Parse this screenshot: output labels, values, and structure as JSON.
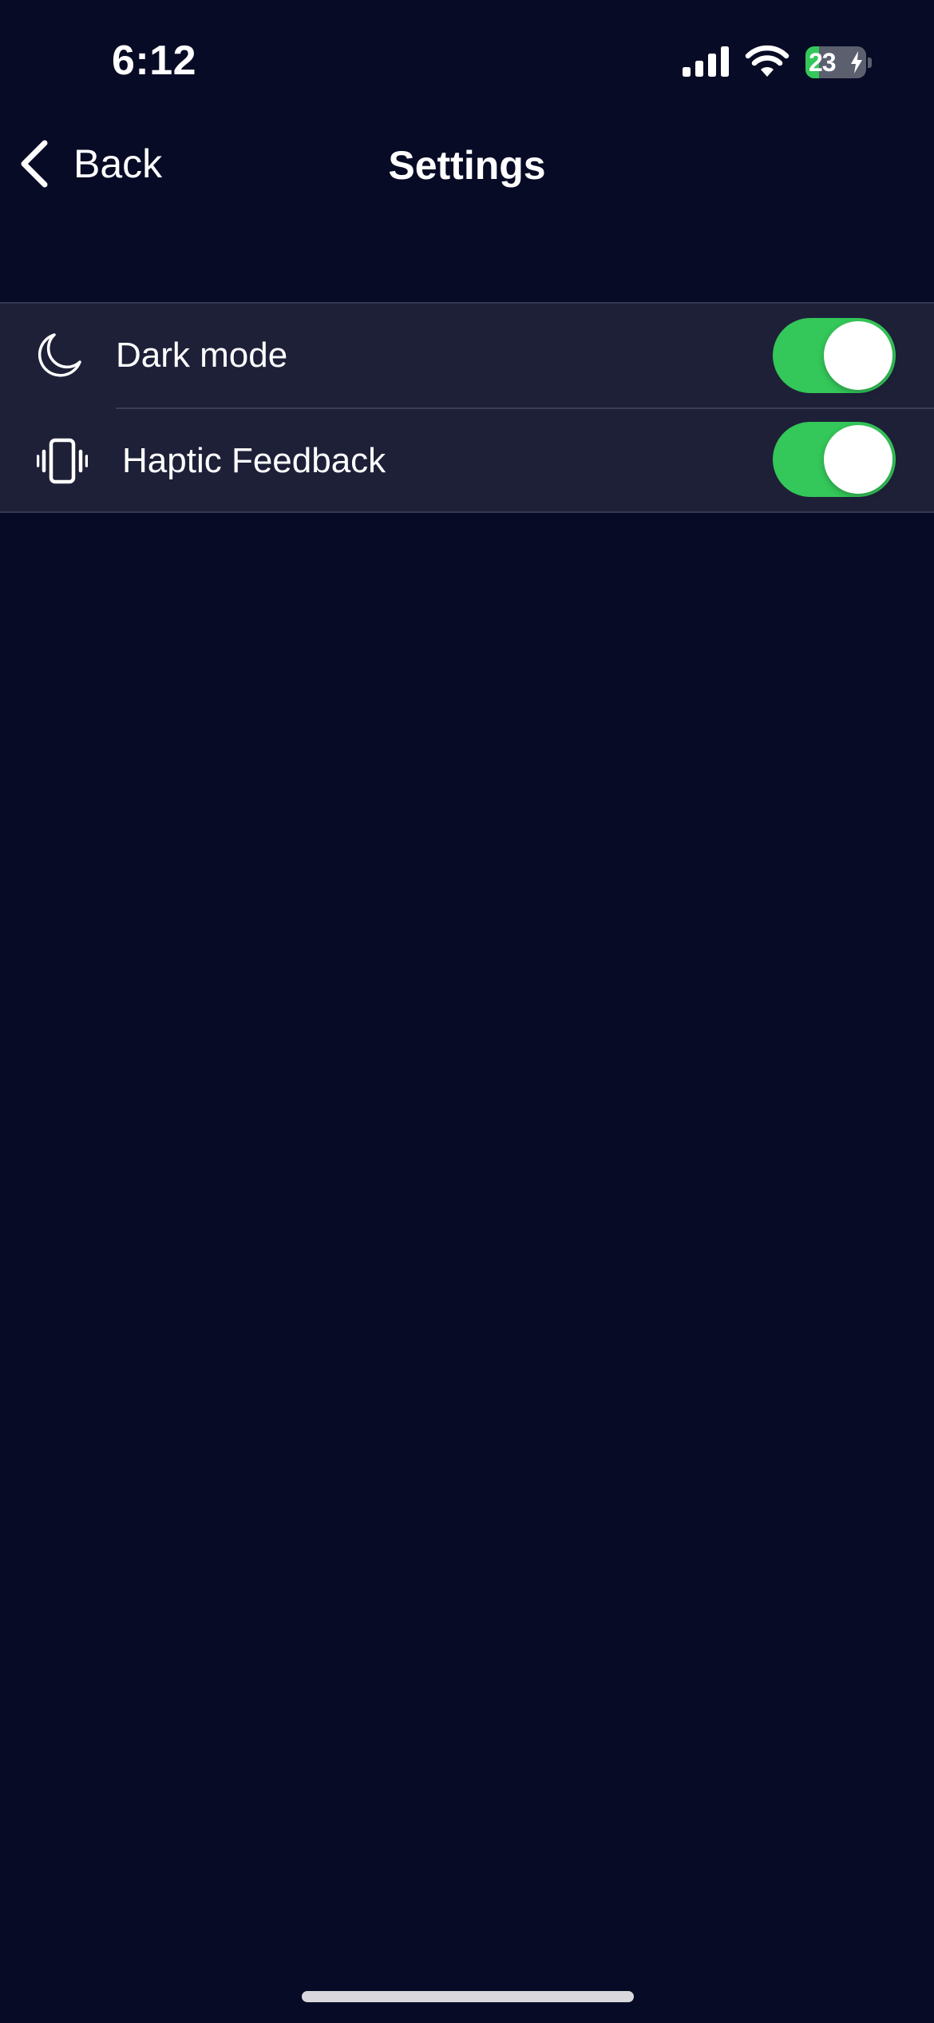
{
  "status_bar": {
    "time": "6:12",
    "battery_level_percent": 23,
    "battery_text": "23",
    "charging": true,
    "icons": [
      "signal-icon",
      "wifi-icon",
      "battery-icon",
      "charging-bolt-icon"
    ]
  },
  "nav": {
    "back_label": "Back",
    "title": "Settings",
    "back_icon": "chevron-left-icon"
  },
  "settings": {
    "items": [
      {
        "label": "Dark mode",
        "icon": "moon-icon",
        "enabled": true
      },
      {
        "label": "Haptic Feedback",
        "icon": "vibration-icon",
        "enabled": true
      }
    ]
  },
  "colors": {
    "background": "#070b25",
    "row_background": "#1e2038",
    "toggle_on": "#34c759",
    "text": "#ffffff"
  }
}
